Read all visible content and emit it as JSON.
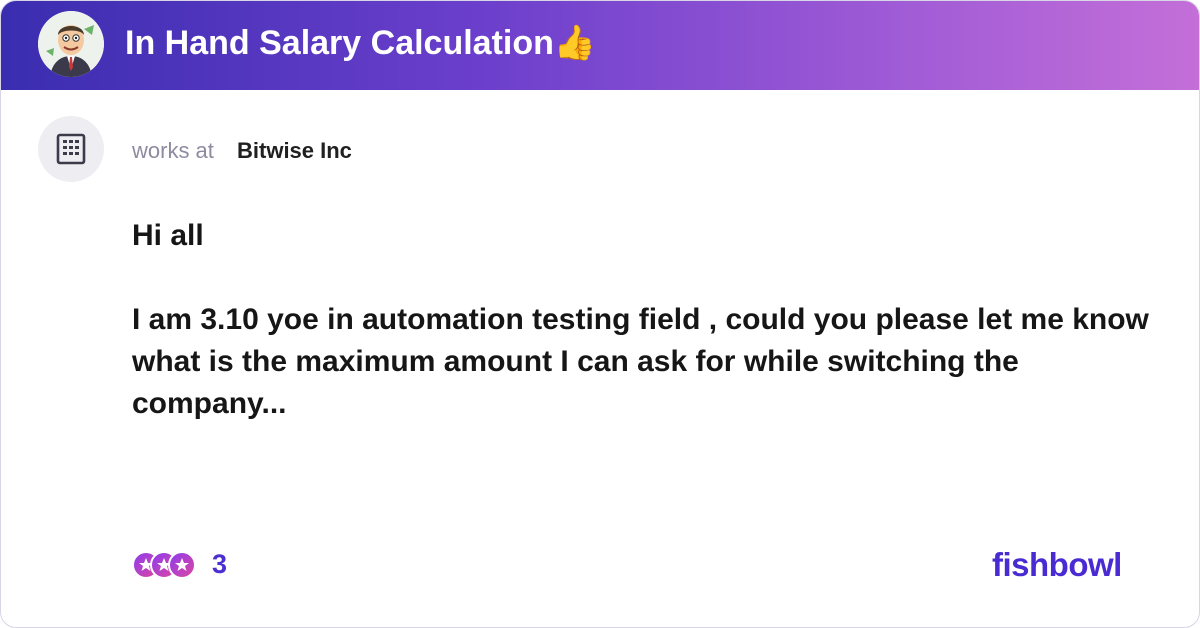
{
  "header": {
    "title": "In Hand Salary Calculation👍",
    "avatar_icon": "businessman-avatar-icon",
    "gradient": [
      "#3a2db0",
      "#c46fd8"
    ]
  },
  "author": {
    "works_at_label": "works at",
    "company": "Bitwise Inc",
    "avatar_icon": "building-icon"
  },
  "post": {
    "greeting": "Hi all",
    "body": "I am 3.10 yoe in automation testing field , could you please let me know what is the maximum amount I can ask for while switching the company..."
  },
  "reactions": {
    "icons": [
      "star-reaction-icon",
      "star-reaction-icon",
      "star-reaction-icon"
    ],
    "count": "3"
  },
  "brand": {
    "name": "fishbowl",
    "color": "#4a2bd3"
  }
}
